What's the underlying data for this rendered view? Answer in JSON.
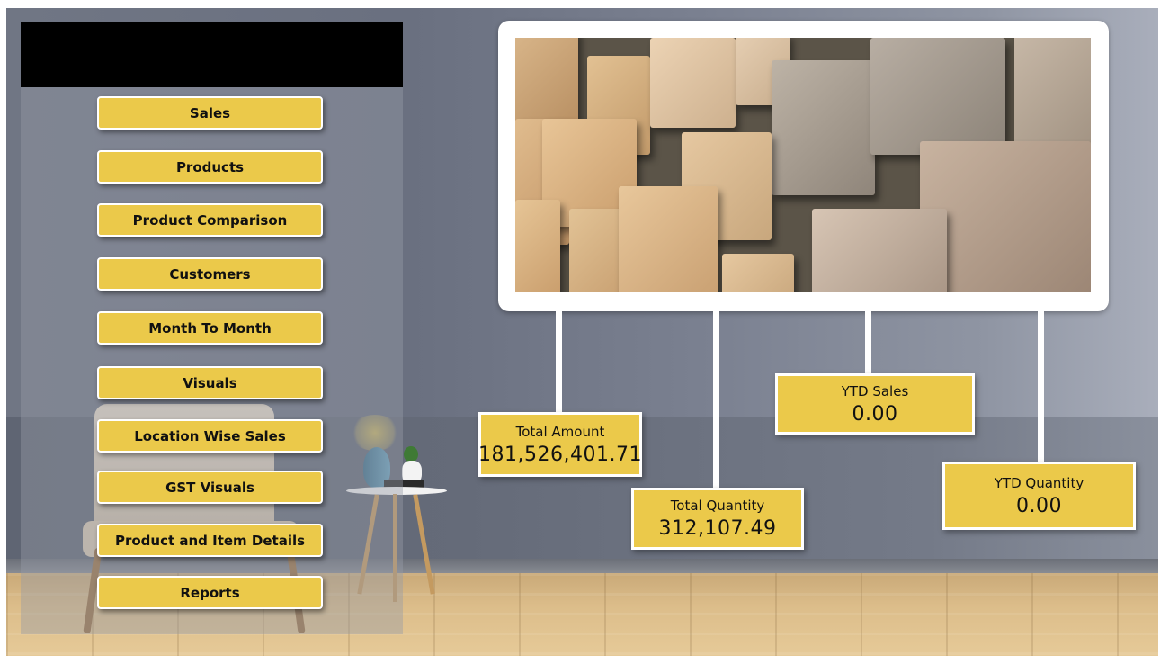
{
  "navigation": {
    "buttons": [
      {
        "label": "Sales"
      },
      {
        "label": "Products"
      },
      {
        "label": "Product Comparison"
      },
      {
        "label": "Customers"
      },
      {
        "label": "Month To Month"
      },
      {
        "label": "Visuals"
      },
      {
        "label": "Location Wise Sales"
      },
      {
        "label": "GST Visuals"
      },
      {
        "label": "Product and Item Details"
      },
      {
        "label": "Reports"
      }
    ]
  },
  "kpis": {
    "total_amount": {
      "label": "Total Amount",
      "value": "181,526,401.71"
    },
    "total_quantity": {
      "label": "Total Quantity",
      "value": "312,107.49"
    },
    "ytd_sales": {
      "label": "YTD Sales",
      "value": "0.00"
    },
    "ytd_quantity": {
      "label": "YTD Quantity",
      "value": "0.00"
    }
  },
  "colors": {
    "accent": "#ebc94a",
    "header": "#000000",
    "frame": "#ffffff"
  }
}
